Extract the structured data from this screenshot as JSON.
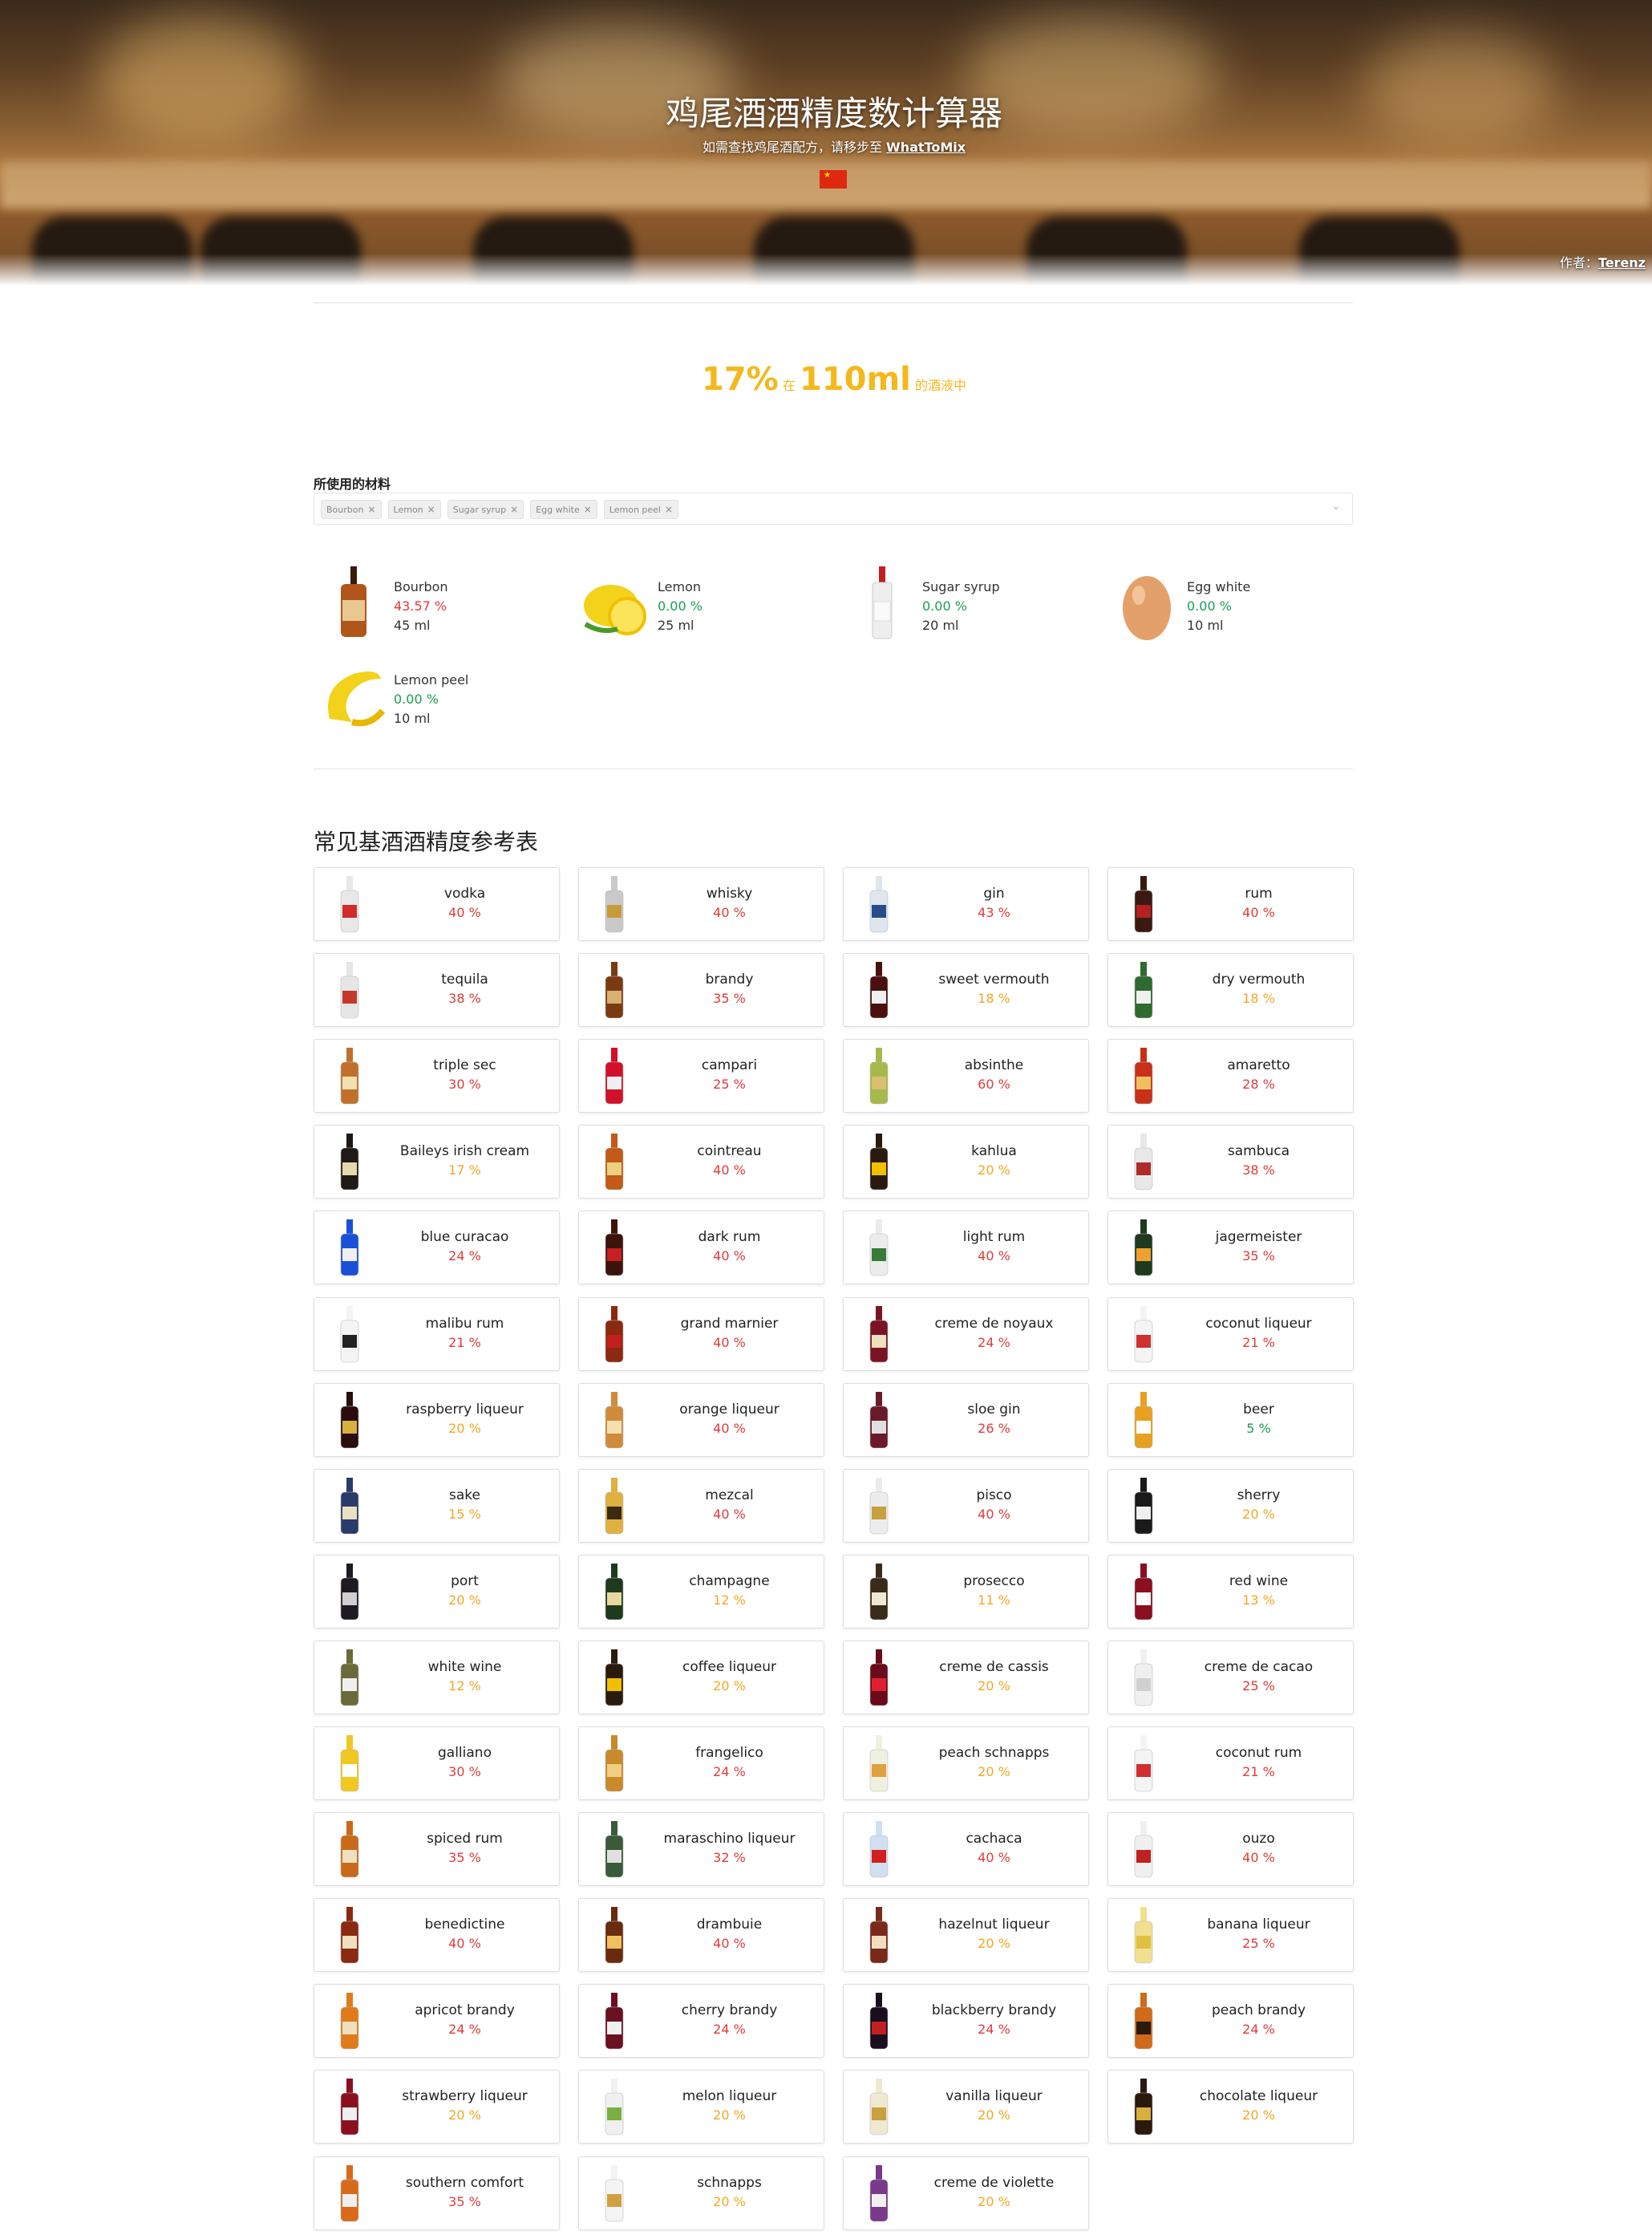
{
  "header": {
    "title": "鸡尾酒酒精度数计算器",
    "subtitle": "如需查找鸡尾酒配方，请移步至",
    "link": "WhatToMix",
    "author_label": "作者：",
    "author": "Terenz"
  },
  "result": {
    "abv": "17%",
    "mid": "在",
    "volume": "110ml",
    "end": "的酒液中"
  },
  "ingredients_label": "所使用的材料",
  "selected": [
    "Bourbon",
    "Lemon",
    "Sugar syrup",
    "Egg white",
    "Lemon peel"
  ],
  "ingredients": [
    {
      "name": "Bourbon",
      "abv": "43.57 %",
      "vol": "45 ml",
      "color": "red",
      "icon": "bourbon-bottle-icon"
    },
    {
      "name": "Lemon",
      "abv": "0.00 %",
      "vol": "25 ml",
      "color": "green",
      "icon": "lemon-icon"
    },
    {
      "name": "Sugar syrup",
      "abv": "0.00 %",
      "vol": "20 ml",
      "color": "green",
      "icon": "syrup-bottle-icon"
    },
    {
      "name": "Egg white",
      "abv": "0.00 %",
      "vol": "10 ml",
      "color": "green",
      "icon": "egg-icon"
    },
    {
      "name": "Lemon peel",
      "abv": "0.00 %",
      "vol": "10 ml",
      "color": "green",
      "icon": "lemon-peel-icon"
    }
  ],
  "reference_title": "常见基酒酒精度参考表",
  "spirits": [
    {
      "name": "vodka",
      "abv": "40 %",
      "level": "red",
      "bottle": "#e8e8e8",
      "label": "#d12b2b"
    },
    {
      "name": "whisky",
      "abv": "40 %",
      "level": "red",
      "bottle": "#c9c9c9",
      "label": "#c89a3a"
    },
    {
      "name": "gin",
      "abv": "43 %",
      "level": "red",
      "bottle": "#dfe6ee",
      "label": "#2a4c8c"
    },
    {
      "name": "rum",
      "abv": "40 %",
      "level": "red",
      "bottle": "#3a1a10",
      "label": "#b52020"
    },
    {
      "name": "tequila",
      "abv": "38 %",
      "level": "red",
      "bottle": "#e6e6e6",
      "label": "#c43a2a"
    },
    {
      "name": "brandy",
      "abv": "35 %",
      "level": "red",
      "bottle": "#7a3b12",
      "label": "#d8b070"
    },
    {
      "name": "sweet vermouth",
      "abv": "18 %",
      "level": "orange",
      "bottle": "#4a1010",
      "label": "#f0f0f0"
    },
    {
      "name": "dry vermouth",
      "abv": "18 %",
      "level": "orange",
      "bottle": "#2f6b2f",
      "label": "#f0f0f0"
    },
    {
      "name": "triple sec",
      "abv": "30 %",
      "level": "red",
      "bottle": "#c0702a",
      "label": "#f4e0b0"
    },
    {
      "name": "campari",
      "abv": "25 %",
      "level": "red",
      "bottle": "#d2102a",
      "label": "#f0f0f0"
    },
    {
      "name": "absinthe",
      "abv": "60 %",
      "level": "red",
      "bottle": "#a7b84a",
      "label": "#d8c070"
    },
    {
      "name": "amaretto",
      "abv": "28 %",
      "level": "red",
      "bottle": "#c8301a",
      "label": "#f0c060"
    },
    {
      "name": "Baileys irish cream",
      "abv": "17 %",
      "level": "orange",
      "bottle": "#1e1a16",
      "label": "#e8d8b0"
    },
    {
      "name": "cointreau",
      "abv": "40 %",
      "level": "red",
      "bottle": "#c25a18",
      "label": "#f0d080"
    },
    {
      "name": "kahlua",
      "abv": "20 %",
      "level": "orange",
      "bottle": "#2a1a0e",
      "label": "#f0c000"
    },
    {
      "name": "sambuca",
      "abv": "38 %",
      "level": "red",
      "bottle": "#e8e8e8",
      "label": "#b02a2a"
    },
    {
      "name": "blue curacao",
      "abv": "24 %",
      "level": "red",
      "bottle": "#1a50d8",
      "label": "#f0f0f0"
    },
    {
      "name": "dark rum",
      "abv": "40 %",
      "level": "red",
      "bottle": "#3a140c",
      "label": "#c82020"
    },
    {
      "name": "light rum",
      "abv": "40 %",
      "level": "red",
      "bottle": "#ececec",
      "label": "#3a7a3a"
    },
    {
      "name": "jagermeister",
      "abv": "35 %",
      "level": "red",
      "bottle": "#1e3a1e",
      "label": "#f0a030"
    },
    {
      "name": "malibu rum",
      "abv": "21 %",
      "level": "red",
      "bottle": "#f4f4f4",
      "label": "#222222"
    },
    {
      "name": "grand marnier",
      "abv": "40 %",
      "level": "red",
      "bottle": "#8a2a10",
      "label": "#c02020"
    },
    {
      "name": "creme de noyaux",
      "abv": "24 %",
      "level": "red",
      "bottle": "#7a1424",
      "label": "#f0e0c0"
    },
    {
      "name": "coconut liqueur",
      "abv": "21 %",
      "level": "red",
      "bottle": "#f4f4f4",
      "label": "#d03030"
    },
    {
      "name": "raspberry liqueur",
      "abv": "20 %",
      "level": "orange",
      "bottle": "#2a0c0c",
      "label": "#d8b040"
    },
    {
      "name": "orange liqueur",
      "abv": "40 %",
      "level": "red",
      "bottle": "#d08a3a",
      "label": "#f4e0b0"
    },
    {
      "name": "sloe gin",
      "abv": "26 %",
      "level": "red",
      "bottle": "#6a1a2a",
      "label": "#e0e0e0"
    },
    {
      "name": "beer",
      "abv": "5 %",
      "level": "green",
      "bottle": "#e8a020",
      "label": "#ffffff"
    },
    {
      "name": "sake",
      "abv": "15 %",
      "level": "orange",
      "bottle": "#2a3a6a",
      "label": "#e8e0c0"
    },
    {
      "name": "mezcal",
      "abv": "40 %",
      "level": "red",
      "bottle": "#e0b040",
      "label": "#3a2a10"
    },
    {
      "name": "pisco",
      "abv": "40 %",
      "level": "red",
      "bottle": "#ececec",
      "label": "#c8a040"
    },
    {
      "name": "sherry",
      "abv": "20 %",
      "level": "orange",
      "bottle": "#1a1a1a",
      "label": "#f0f0f0"
    },
    {
      "name": "port",
      "abv": "20 %",
      "level": "orange",
      "bottle": "#1e1a22",
      "label": "#d0d0d0"
    },
    {
      "name": "champagne",
      "abv": "12 %",
      "level": "orange",
      "bottle": "#1e3a1e",
      "label": "#e8d8a0"
    },
    {
      "name": "prosecco",
      "abv": "11 %",
      "level": "orange",
      "bottle": "#3a2a1a",
      "label": "#f0e8d0"
    },
    {
      "name": "red wine",
      "abv": "13 %",
      "level": "orange",
      "bottle": "#8a1020",
      "label": "#ffffff"
    },
    {
      "name": "white wine",
      "abv": "12 %",
      "level": "orange",
      "bottle": "#6a6a3a",
      "label": "#f0f0f0"
    },
    {
      "name": "coffee liqueur",
      "abv": "20 %",
      "level": "orange",
      "bottle": "#2a1a0e",
      "label": "#f0c000"
    },
    {
      "name": "creme de cassis",
      "abv": "20 %",
      "level": "orange",
      "bottle": "#6a0a1a",
      "label": "#e02030"
    },
    {
      "name": "creme de cacao",
      "abv": "25 %",
      "level": "red",
      "bottle": "#f0f0f0",
      "label": "#d0d0d0"
    },
    {
      "name": "galliano",
      "abv": "30 %",
      "level": "red",
      "bottle": "#f0c820",
      "label": "#ffffff"
    },
    {
      "name": "frangelico",
      "abv": "24 %",
      "level": "red",
      "bottle": "#c88a2a",
      "label": "#f0d080"
    },
    {
      "name": "peach schnapps",
      "abv": "20 %",
      "level": "orange",
      "bottle": "#f0f0e0",
      "label": "#e0a040"
    },
    {
      "name": "coconut rum",
      "abv": "21 %",
      "level": "red",
      "bottle": "#f4f4f4",
      "label": "#d03030"
    },
    {
      "name": "spiced rum",
      "abv": "35 %",
      "level": "red",
      "bottle": "#c86a1a",
      "label": "#f0e0c0"
    },
    {
      "name": "maraschino liqueur",
      "abv": "32 %",
      "level": "red",
      "bottle": "#3a5a3a",
      "label": "#e0e0e0"
    },
    {
      "name": "cachaca",
      "abv": "40 %",
      "level": "red",
      "bottle": "#d0e0f0",
      "label": "#d02020"
    },
    {
      "name": "ouzo",
      "abv": "40 %",
      "level": "red",
      "bottle": "#f0f0f0",
      "label": "#c02020"
    },
    {
      "name": "benedictine",
      "abv": "40 %",
      "level": "red",
      "bottle": "#8a2a10",
      "label": "#f0e0c0"
    },
    {
      "name": "drambuie",
      "abv": "40 %",
      "level": "red",
      "bottle": "#6a2a0e",
      "label": "#f0c060"
    },
    {
      "name": "hazelnut liqueur",
      "abv": "20 %",
      "level": "orange",
      "bottle": "#7a2a1a",
      "label": "#f0e0c0"
    },
    {
      "name": "banana liqueur",
      "abv": "25 %",
      "level": "red",
      "bottle": "#f0e090",
      "label": "#e0c040"
    },
    {
      "name": "apricot brandy",
      "abv": "24 %",
      "level": "red",
      "bottle": "#e07a1a",
      "label": "#f0e0c0"
    },
    {
      "name": "cherry brandy",
      "abv": "24 %",
      "level": "red",
      "bottle": "#6a1020",
      "label": "#f0f0f0"
    },
    {
      "name": "blackberry brandy",
      "abv": "24 %",
      "level": "red",
      "bottle": "#1a0e1e",
      "label": "#c02020"
    },
    {
      "name": "peach brandy",
      "abv": "24 %",
      "level": "red",
      "bottle": "#d06a1a",
      "label": "#2a1a0e"
    },
    {
      "name": "strawberry liqueur",
      "abv": "20 %",
      "level": "orange",
      "bottle": "#8a1020",
      "label": "#f0f0f0"
    },
    {
      "name": "melon liqueur",
      "abv": "20 %",
      "level": "orange",
      "bottle": "#f0f0f0",
      "label": "#7ab040"
    },
    {
      "name": "vanilla liqueur",
      "abv": "20 %",
      "level": "orange",
      "bottle": "#f0e8d0",
      "label": "#c8a040"
    },
    {
      "name": "chocolate liqueur",
      "abv": "20 %",
      "level": "orange",
      "bottle": "#2a1a0e",
      "label": "#d8b040"
    },
    {
      "name": "southern comfort",
      "abv": "35 %",
      "level": "red",
      "bottle": "#d86a1a",
      "label": "#f0f0f0"
    },
    {
      "name": "schnapps",
      "abv": "20 %",
      "level": "orange",
      "bottle": "#f4f4f4",
      "label": "#d0a040"
    },
    {
      "name": "creme de violette",
      "abv": "20 %",
      "level": "orange",
      "bottle": "#7a3a8a",
      "label": "#f0f0f0"
    }
  ],
  "colors": {
    "red": "#e03b3b",
    "green": "#1b9e54",
    "orange": "#f5a623",
    "accent": "#f5b81c"
  }
}
